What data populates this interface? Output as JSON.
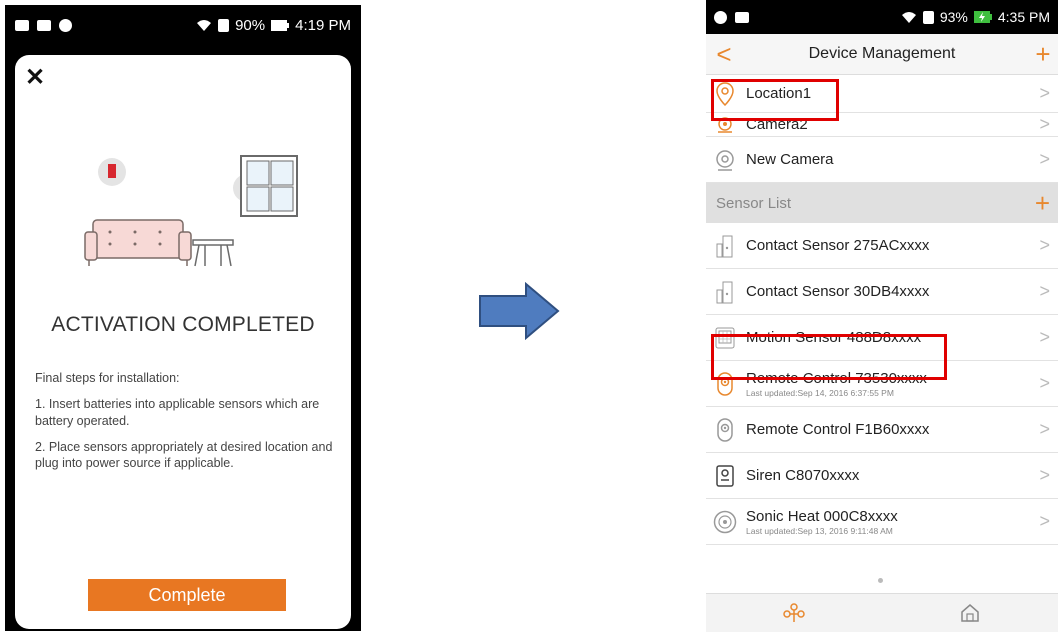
{
  "left": {
    "status": {
      "wifi": "wifi-icon",
      "battery": "90%",
      "time": "4:19 PM"
    },
    "close_label": "✕",
    "title": "ACTIVATION COMPLETED",
    "steps_intro": "Final steps for installation:",
    "step1": "1. Insert batteries into applicable sensors which are battery operated.",
    "step2": "2. Place sensors appropriately at desired location and plug into power source if applicable.",
    "complete_label": "Complete"
  },
  "right": {
    "status": {
      "battery": "93%",
      "time": "4:35 PM"
    },
    "nav": {
      "back": "<",
      "title": "Device Management",
      "add": "+"
    },
    "devices": [
      {
        "name": "Location1"
      },
      {
        "name": "Camera2"
      },
      {
        "name": "New Camera"
      }
    ],
    "sensor_header": "Sensor List",
    "sensor_add": "+",
    "sensors": [
      {
        "name": "Contact Sensor 275ACxxxx",
        "sub": ""
      },
      {
        "name": "Contact Sensor 30DB4xxxx",
        "sub": ""
      },
      {
        "name": "Motion Sensor 488D8xxxx",
        "sub": ""
      },
      {
        "name": "Remote Control 73530xxxx",
        "sub": "Last updated:Sep 14, 2016 6:37:55 PM"
      },
      {
        "name": "Remote Control F1B60xxxx",
        "sub": ""
      },
      {
        "name": "Siren C8070xxxx",
        "sub": ""
      },
      {
        "name": "Sonic Heat 000C8xxxx",
        "sub": "Last updated:Sep 13, 2016 9:11:48 AM"
      }
    ],
    "chevron": ">",
    "colors": {
      "accent": "#e8882e",
      "highlight": "#e00000"
    }
  }
}
